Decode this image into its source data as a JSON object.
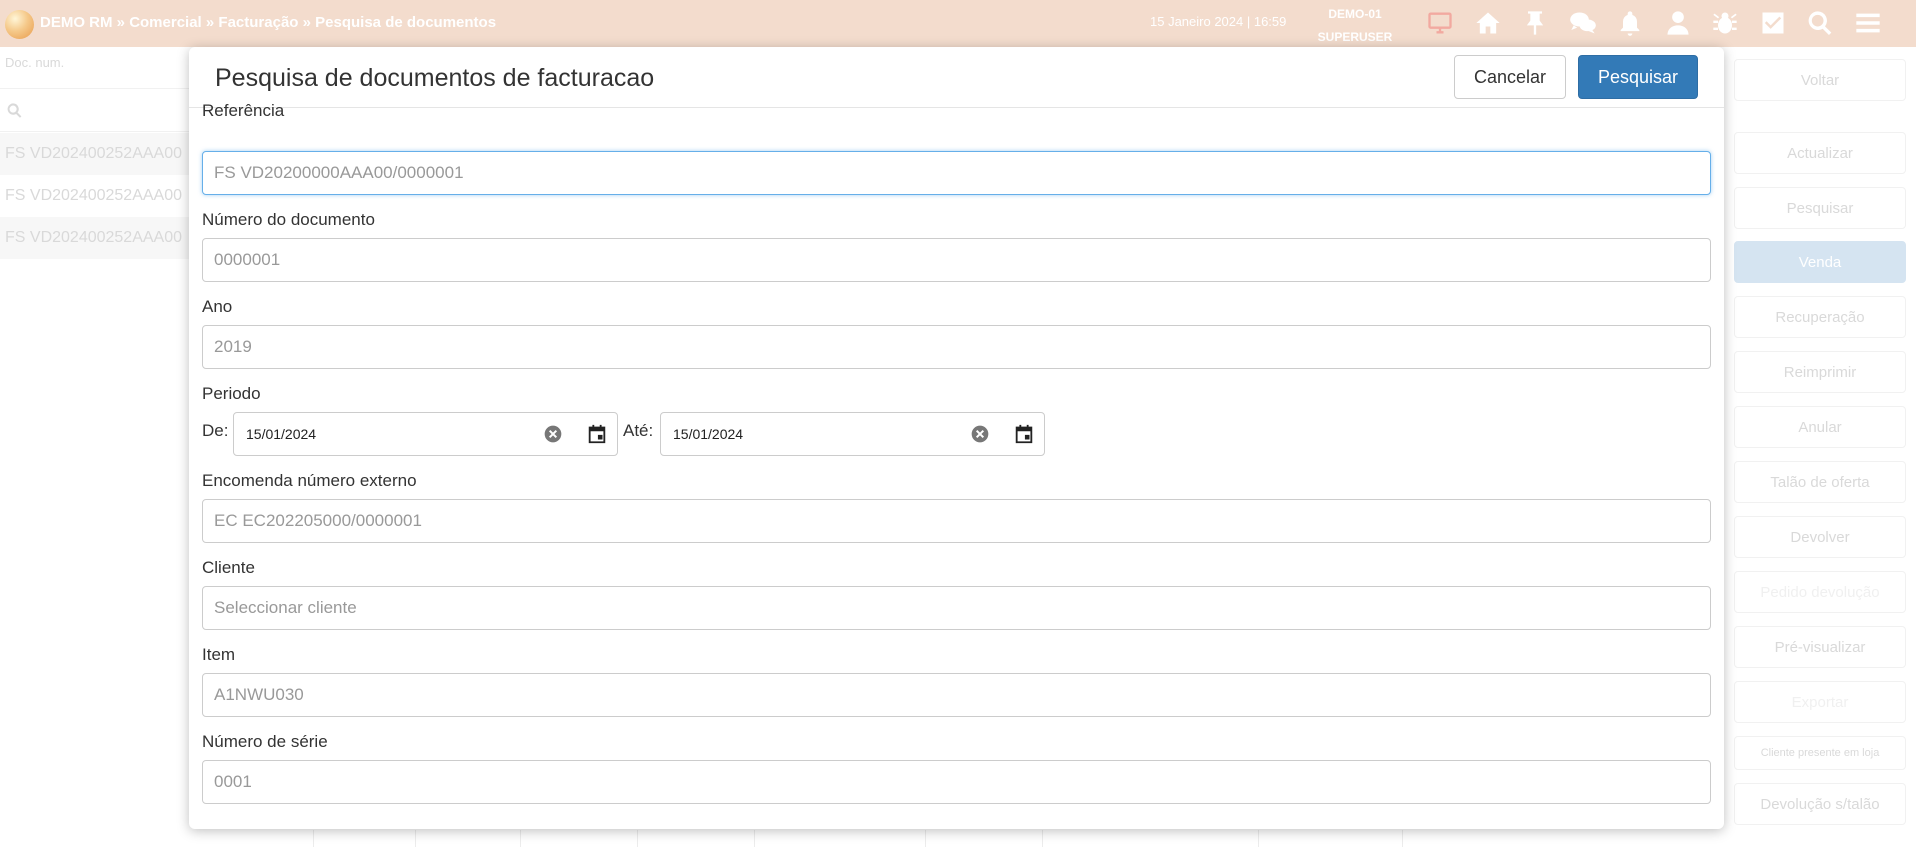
{
  "topbar": {
    "breadcrumb": {
      "app": "DEMO RM",
      "sep": " » ",
      "level1": "Comercial",
      "level2": "Facturação",
      "level3": "Pesquisa de documentos"
    },
    "datetime": "15 Janeiro 2024 | 16:59",
    "company": "DEMO-01",
    "user": "SUPERUSER",
    "icons": [
      "monitor-icon",
      "home-icon",
      "pin-icon",
      "chat-icon",
      "bell-icon",
      "user-icon",
      "bug-icon",
      "checkbox-icon",
      "search-icon",
      "menu-icon"
    ],
    "colors": {
      "bar": "#f3dccd",
      "text": "#ffffff",
      "monitor": "#f2a9a0"
    }
  },
  "background": {
    "filter_placeholder": "Doc. num.",
    "rows": [
      "FS VD202400252AAA00",
      "FS VD202400252AAA00",
      "FS VD202400252AAA00"
    ],
    "right_buttons": [
      "Voltar",
      "Actualizar",
      "Pesquisar",
      "Venda",
      "Recuperação",
      "Reimprimir",
      "Anular",
      "Talão de oferta",
      "Devolver",
      "Pedido devolução",
      "Pré-visualizar",
      "Exportar",
      "Cliente presente em loja",
      "Devolução s/talão"
    ]
  },
  "modal": {
    "title": "Pesquisa de documentos de facturacao",
    "cancel_label": "Cancelar",
    "search_label": "Pesquisar",
    "colors": {
      "primary": "#337ab7",
      "focus": "#66afe9"
    },
    "fields": {
      "referencia": {
        "label": "Referência",
        "placeholder": "FS VD20200000AAA00/0000001",
        "value": ""
      },
      "numero_documento": {
        "label": "Número do documento",
        "placeholder": "0000001",
        "value": ""
      },
      "ano": {
        "label": "Ano",
        "placeholder": "2019",
        "value": ""
      },
      "periodo": {
        "label": "Periodo",
        "from_label": "De:",
        "from_value": "15/01/2024",
        "to_label": "Até:",
        "to_value": "15/01/2024"
      },
      "encomenda": {
        "label": "Encomenda número externo",
        "placeholder": "EC EC202205000/0000001",
        "value": ""
      },
      "cliente": {
        "label": "Cliente",
        "placeholder": "Seleccionar cliente",
        "value": ""
      },
      "item": {
        "label": "Item",
        "placeholder": "A1NWU030",
        "value": ""
      },
      "numero_serie": {
        "label": "Número de série",
        "placeholder": "0001",
        "value": ""
      }
    }
  }
}
